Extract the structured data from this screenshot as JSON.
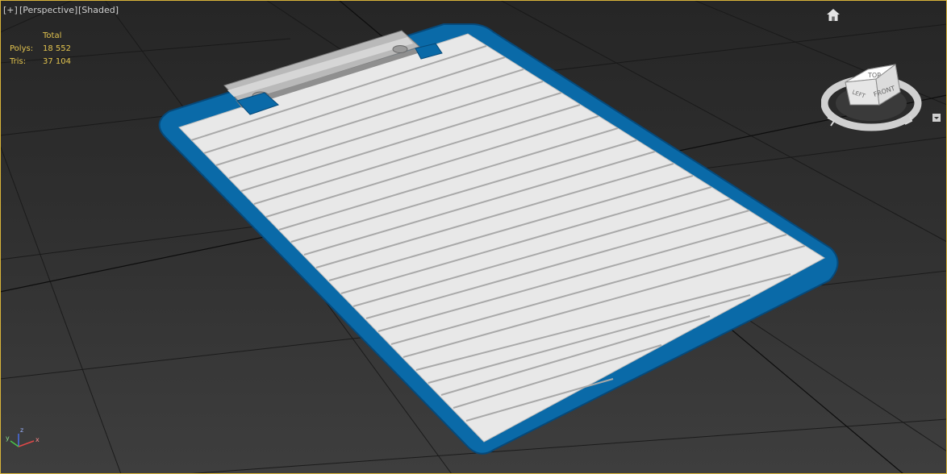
{
  "viewport": {
    "labels": {
      "plus": "[+]",
      "view": "[Perspective]",
      "shading": "[Shaded]"
    }
  },
  "stats": {
    "header": "Total",
    "rows": [
      {
        "label": "Polys:",
        "value": "18 552"
      },
      {
        "label": "Tris:",
        "value": "37 104"
      }
    ]
  },
  "viewcube": {
    "top": "TOP",
    "front": "FRONT",
    "left": "LEFT"
  },
  "axes": {
    "x": "x",
    "y": "y",
    "z": "z"
  },
  "icons": {
    "home": "home-icon",
    "viewcube_menu": "chevron-down-icon"
  },
  "colors": {
    "selection_border": "#d8b43a",
    "stats_text": "#e3c44f",
    "clipboard_blue": "#0a6aa8",
    "paper": "#e6e6e6"
  }
}
